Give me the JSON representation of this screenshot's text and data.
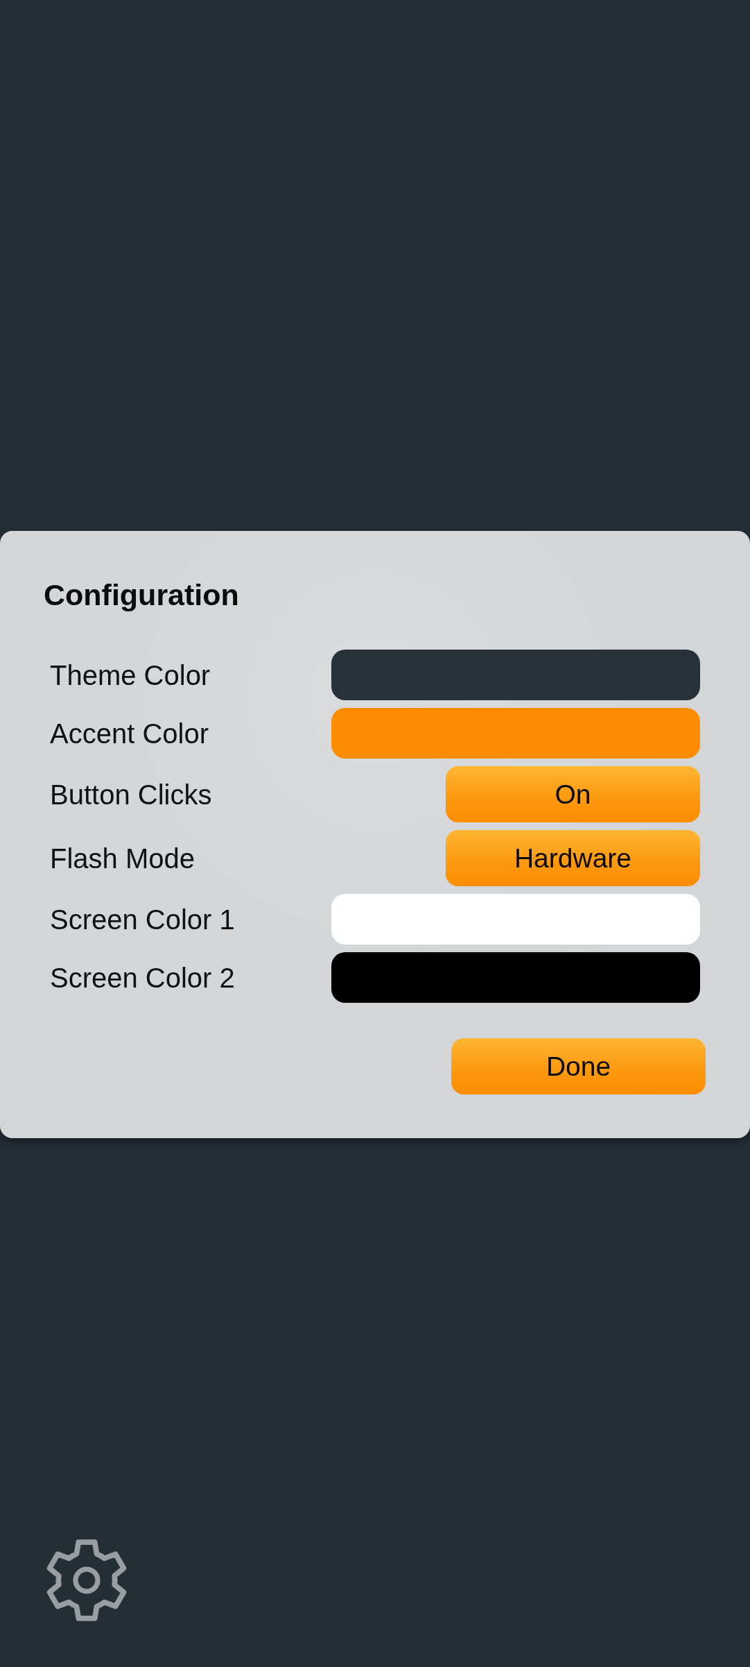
{
  "dialog": {
    "title": "Configuration",
    "settings": [
      {
        "label": "Theme Color",
        "kind": "swatch",
        "color": "#263139"
      },
      {
        "label": "Accent Color",
        "kind": "swatch",
        "color": "#fb8c00"
      },
      {
        "label": "Button Clicks",
        "kind": "option",
        "value": "On"
      },
      {
        "label": "Flash Mode",
        "kind": "option",
        "value": "Hardware"
      },
      {
        "label": "Screen Color 1",
        "kind": "swatch",
        "color": "#ffffff"
      },
      {
        "label": "Screen Color 2",
        "kind": "swatch",
        "color": "#000000"
      }
    ],
    "done_button": "Done"
  }
}
